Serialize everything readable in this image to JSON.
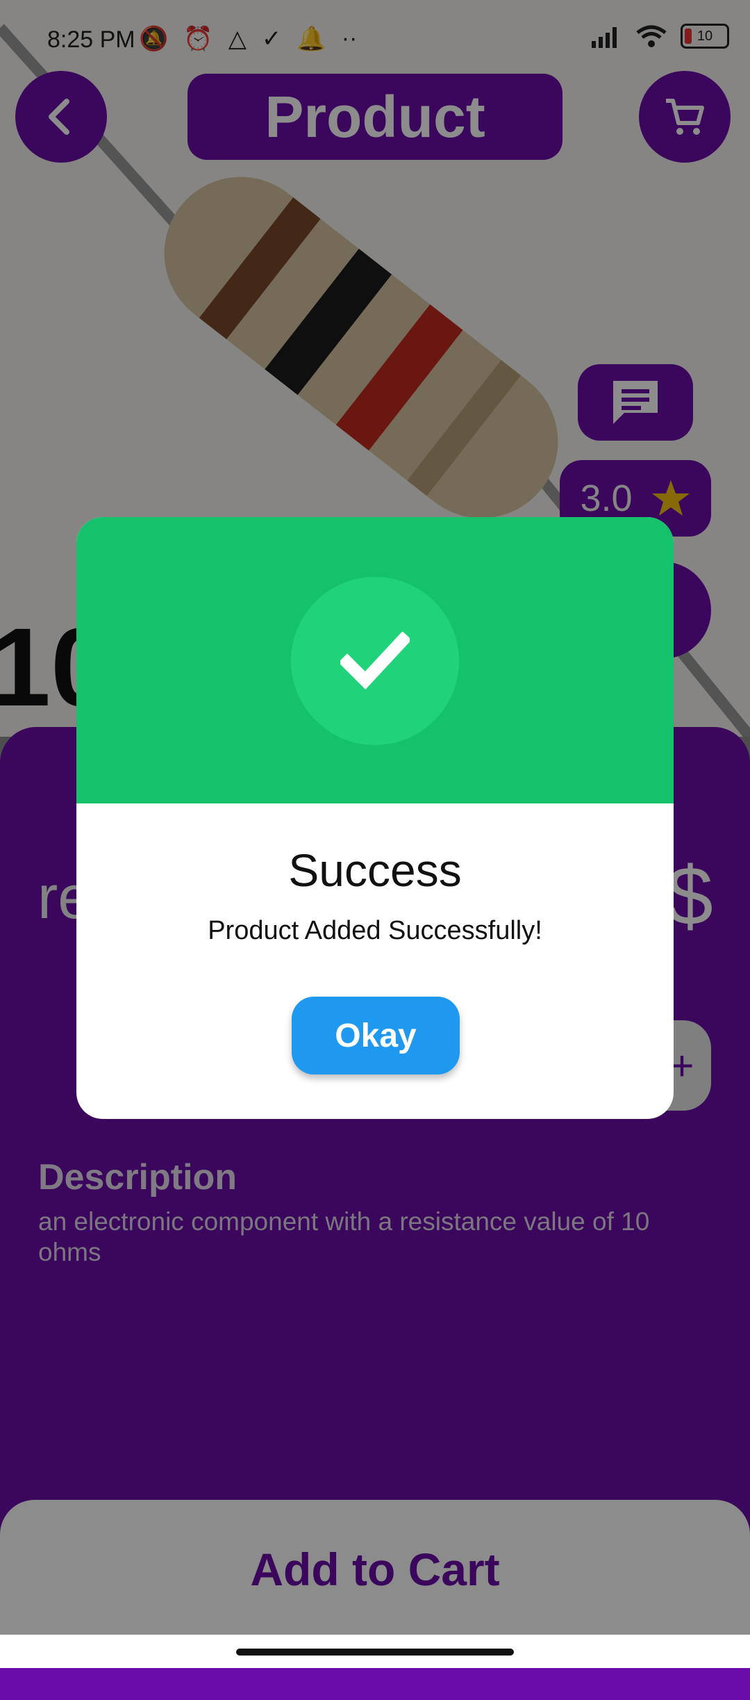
{
  "status_bar": {
    "time": "8:25 PM",
    "battery": "10",
    "icons": [
      "mute-icon",
      "alarm-icon",
      "drive-icon",
      "task-icon",
      "bell-icon",
      "more-dots-icon"
    ],
    "right_icons": [
      "signal-icon",
      "wifi-icon",
      "battery-icon"
    ]
  },
  "header": {
    "title": "Product",
    "back_icon": "chevron-left-icon",
    "cart_icon": "cart-icon"
  },
  "product": {
    "rating": "3.0",
    "review_icon": "comment-icon",
    "rating_icon": "star-icon",
    "size_label_partial": "10",
    "name_partial": "re",
    "price_partial": "$",
    "qty_partial": "+",
    "description_heading": "Description",
    "description_text": "an electronic component with a resistance value of 10 ohms"
  },
  "footer": {
    "add_to_cart_label": "Add to Cart"
  },
  "dialog": {
    "icon": "check-icon",
    "title": "Success",
    "message": "Product Added Successfully!",
    "okay_label": "Okay"
  },
  "colors": {
    "brand_purple": "#6a0da8",
    "success_green": "#15c26b",
    "success_circle": "#20d37a",
    "okay_blue": "#1f99f0",
    "star": "#f4c20d"
  }
}
